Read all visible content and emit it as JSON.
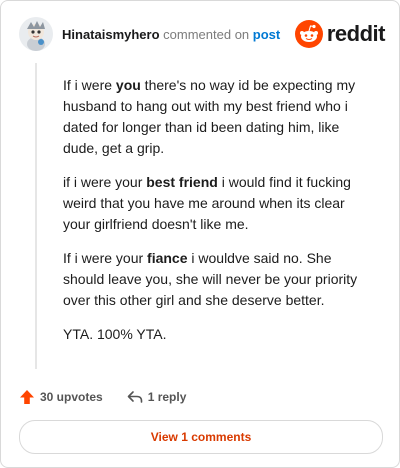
{
  "comment": {
    "username": "Hinataismyhero",
    "commented_on": "commented on",
    "post_link": "post",
    "brand": "reddit",
    "paragraphs": [
      {
        "pre": "If i were ",
        "bold": "you",
        "post": " there's no way id be expecting my husband to hang out with my best friend who i dated for longer than id been dating him, like dude, get a grip."
      },
      {
        "pre": "if i were your ",
        "bold": "best friend",
        "post": " i would find it fucking weird that you have me around when its clear your girlfriend doesn't like me."
      },
      {
        "pre": "If i were your ",
        "bold": "fiance",
        "post": " i wouldve said no. She should leave you, she will never be your priority over this other girl and she deserve better."
      },
      {
        "pre": "YTA. 100% YTA.",
        "bold": "",
        "post": ""
      }
    ]
  },
  "actions": {
    "upvotes": "30 upvotes",
    "replies": "1 reply",
    "view_comments": "View 1 comments"
  },
  "colors": {
    "accent": "#ff4500",
    "link": "#0079d3",
    "view_button_text": "#d93a00"
  },
  "icons": {
    "upvote": "upvote-arrow-icon",
    "reply": "reply-arrow-icon",
    "logo": "reddit-snoo-icon",
    "avatar": "user-avatar"
  }
}
